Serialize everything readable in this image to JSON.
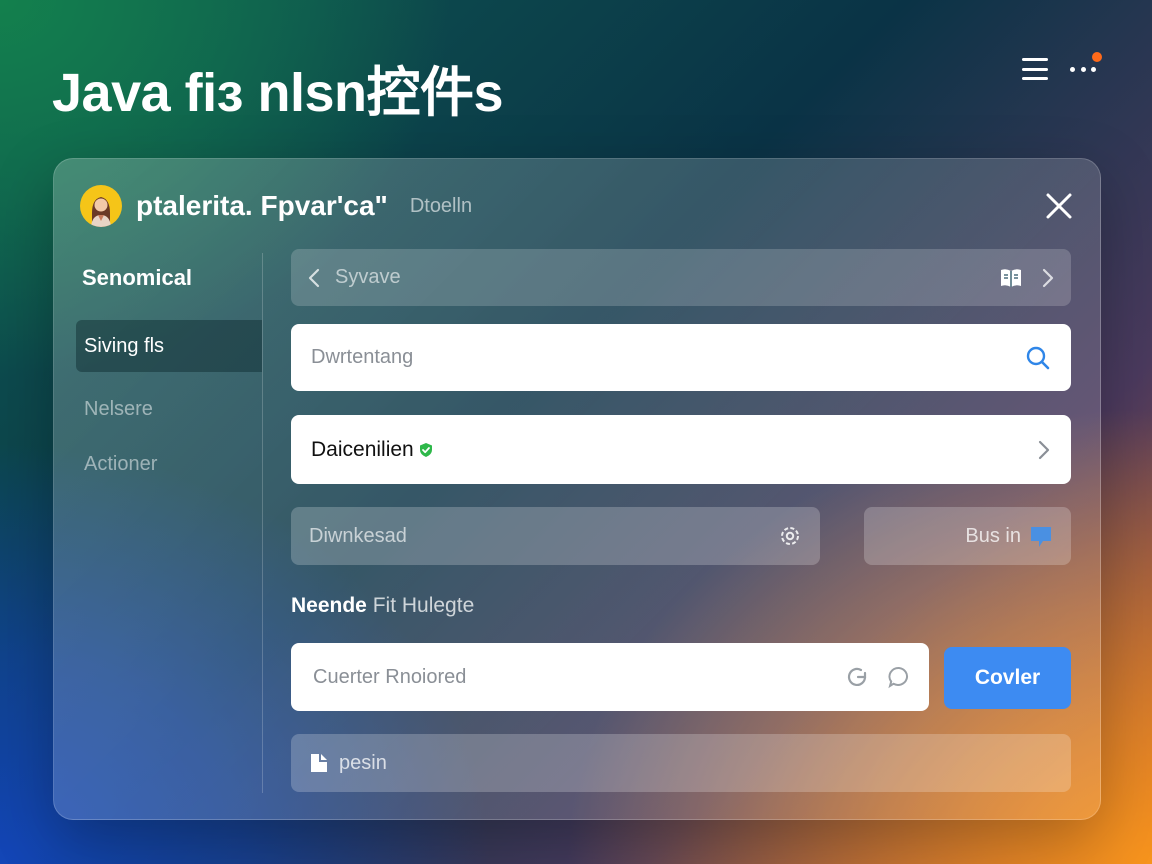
{
  "page": {
    "title": "Java fiз nlsn控件s"
  },
  "colors": {
    "accent": "#3d8bf2",
    "notification": "#ff6a1a",
    "avatar_bg": "#f5c518",
    "verified": "#2eb84a"
  },
  "icons": {
    "menu": "hamburger-icon",
    "more": "more-icon",
    "close": "close-icon",
    "back": "chevron-left-icon",
    "forward": "chevron-right-icon",
    "book": "book-icon",
    "search": "search-icon",
    "verified": "verified-badge-icon",
    "settings": "gear-icon",
    "refresh": "refresh-icon",
    "chat": "chat-bubble-icon",
    "bus_badge": "blue-tag-icon",
    "pesan": "document-icon"
  },
  "panel": {
    "title": "ptalerita. Fpvar'ca\"",
    "subtitle": "Dtoelln"
  },
  "sidebar": {
    "heading": "Senomical",
    "items": [
      {
        "label": "Siving fls",
        "active": true
      },
      {
        "label": "Nelsere",
        "active": false
      },
      {
        "label": "Actioner",
        "active": false
      }
    ]
  },
  "nav": {
    "label": "Syvave"
  },
  "search": {
    "placeholder": "Dwrtentang"
  },
  "select": {
    "value": "Daicenilien"
  },
  "download": {
    "label": "Diwnkesad"
  },
  "bus_button": {
    "label": "Bus in"
  },
  "section": {
    "label_bold": "Neende",
    "label_light": "Fit Hulegte"
  },
  "comment": {
    "placeholder": "Cuerter Rnoiored"
  },
  "primary_button": {
    "label": "Covler"
  },
  "pesan": {
    "label": "pesin"
  }
}
